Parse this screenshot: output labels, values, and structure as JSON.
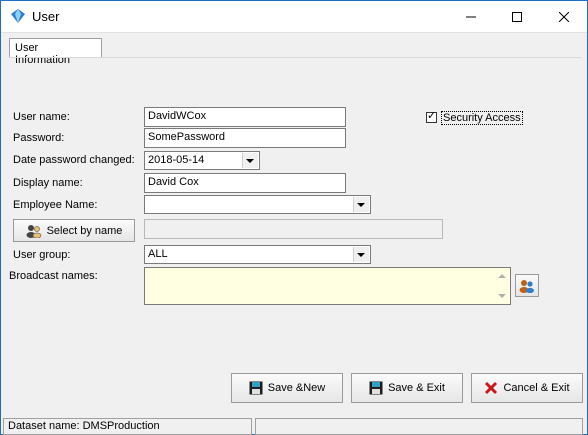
{
  "window": {
    "title": "User",
    "minimize_icon": "minimize-icon",
    "maximize_icon": "maximize-icon",
    "close_icon": "close-icon"
  },
  "tab": {
    "label": "User Information"
  },
  "form": {
    "user_name_label": "User name:",
    "user_name_value": "DavidWCox",
    "password_label": "Password:",
    "password_value": "SomePassword",
    "date_changed_label": "Date password changed:",
    "date_changed_value": "2018-05-14",
    "display_name_label": "Display name:",
    "display_name_value": "David Cox",
    "employee_name_label": "Employee Name:",
    "employee_name_value": "",
    "select_by_name_label": "Select by name",
    "select_by_name_value": "",
    "user_group_label": "User group:",
    "user_group_value": "ALL",
    "broadcast_names_label": "Broadcast names:",
    "broadcast_names_value": "",
    "security_access_label": "Security Access",
    "security_access_checked": true
  },
  "buttons": {
    "save_new": "Save &New",
    "save_exit": "Save & Exit",
    "cancel_exit": "Cancel & Exit"
  },
  "status": {
    "dataset": "Dataset name:  DMSProduction",
    "pane2": ""
  }
}
